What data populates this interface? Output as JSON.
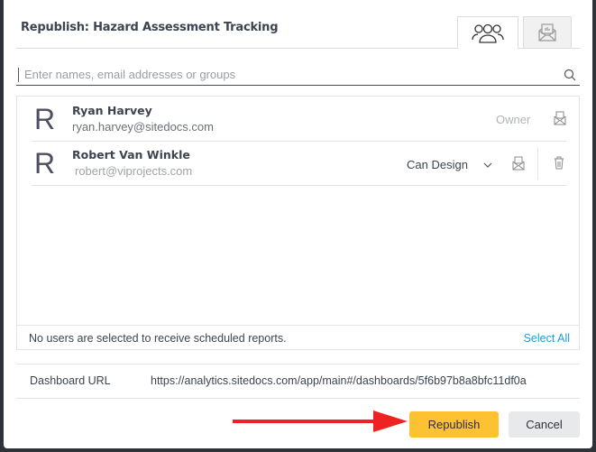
{
  "dialog": {
    "title": "Republish:  Hazard Assessment Tracking",
    "tabs": [
      {
        "icon": "users-icon",
        "active": true
      },
      {
        "icon": "report-envelope-icon",
        "active": false
      }
    ],
    "search": {
      "placeholder": "Enter names, email addresses or groups",
      "value": ""
    },
    "users": [
      {
        "initial": "R",
        "name": "Ryan Harvey",
        "email": "ryan.harvey@sitedocs.com",
        "role": "Owner"
      },
      {
        "initial": "R",
        "name": "Robert Van Winkle",
        "email": "robert@viprojects.com",
        "role": "Can Design"
      }
    ],
    "footer": {
      "message": "No users are selected to receive scheduled reports.",
      "select_all": "Select All"
    },
    "dashboard_url": {
      "label": "Dashboard URL",
      "value": "https://analytics.sitedocs.com/app/main#/dashboards/5f6b97b8a8bfc11df0a"
    },
    "buttons": {
      "republish": "Republish",
      "cancel": "Cancel"
    },
    "colors": {
      "primary": "#fdc232",
      "link": "#1a9ee0",
      "annotation_arrow": "#ee2222"
    }
  }
}
